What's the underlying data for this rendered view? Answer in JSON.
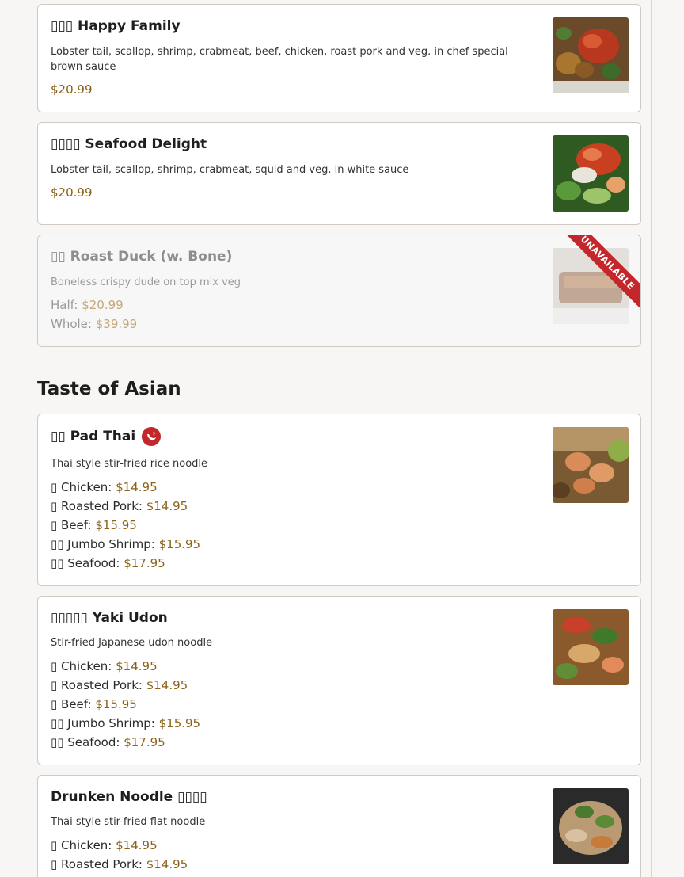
{
  "section_title": "Taste of Asian",
  "items": [
    {
      "title": "▯▯▯ Happy Family",
      "description": "Lobster tail, scallop, shrimp, crabmeat, beef, chicken, roast pork and veg. in chef special brown sauce",
      "price": "$20.99",
      "image": "happy-family-photo"
    },
    {
      "title": "▯▯▯▯ Seafood Delight",
      "description": "Lobster tail, scallop, shrimp, crabmeat, squid and veg. in white sauce",
      "price": "$20.99",
      "image": "seafood-delight-photo"
    },
    {
      "title": "▯▯ Roast Duck (w. Bone)",
      "description": "Boneless crispy dude on top mix veg",
      "ribbon": "UNAVAILABLE",
      "options": [
        {
          "label": "Half: ",
          "price": "$20.99"
        },
        {
          "label": "Whole: ",
          "price": "$39.99"
        }
      ],
      "image": "roast-duck-photo"
    },
    {
      "title": "▯▯ Pad Thai",
      "icon": "spicy-chili-icon",
      "description": "Thai style stir-fried rice noodle",
      "options": [
        {
          "label": "▯ Chicken: ",
          "price": "$14.95"
        },
        {
          "label": "▯ Roasted Pork: ",
          "price": "$14.95"
        },
        {
          "label": "▯ Beef: ",
          "price": "$15.95"
        },
        {
          "label": "▯▯ Jumbo Shrimp: ",
          "price": "$15.95"
        },
        {
          "label": "▯▯ Seafood: ",
          "price": "$17.95"
        }
      ],
      "image": "pad-thai-photo"
    },
    {
      "title": "▯▯▯▯▯ Yaki Udon",
      "description": "Stir-fried Japanese udon noodle",
      "options": [
        {
          "label": "▯ Chicken: ",
          "price": "$14.95"
        },
        {
          "label": "▯ Roasted Pork: ",
          "price": "$14.95"
        },
        {
          "label": "▯ Beef: ",
          "price": "$15.95"
        },
        {
          "label": "▯▯ Jumbo Shrimp: ",
          "price": "$15.95"
        },
        {
          "label": "▯▯ Seafood: ",
          "price": "$17.95"
        }
      ],
      "image": "yaki-udon-photo"
    },
    {
      "title": "Drunken Noodle ▯▯▯▯",
      "description": "Thai style stir-fried flat noodle",
      "options": [
        {
          "label": "▯ Chicken: ",
          "price": "$14.95"
        },
        {
          "label": "▯ Roasted Pork: ",
          "price": "$14.95"
        }
      ],
      "image": "drunken-noodle-photo"
    }
  ],
  "colors": {
    "price": "#8a6219",
    "ribbon": "#c3262b",
    "chili": "#c3262b"
  }
}
